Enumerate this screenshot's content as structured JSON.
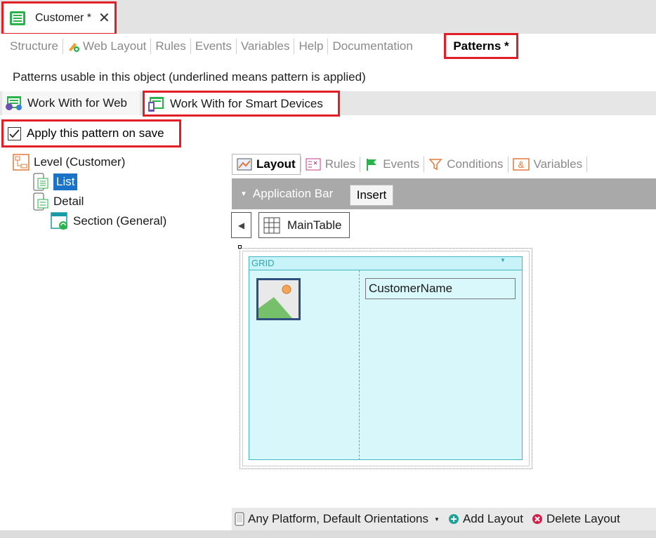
{
  "document_tab": {
    "label": "Customer *",
    "close_glyph": "✕",
    "icon": "transaction-icon"
  },
  "object_tabs": [
    {
      "label": "Structure"
    },
    {
      "label": "Web Layout",
      "icon": "web-layout-icon"
    },
    {
      "label": "Rules"
    },
    {
      "label": "Events"
    },
    {
      "label": "Variables"
    },
    {
      "label": "Help"
    },
    {
      "label": "Documentation"
    }
  ],
  "active_object_tab": "Patterns *",
  "description": "Patterns usable in this object (underlined means pattern is applied)",
  "pattern_tabs": {
    "web": "Work With for Web",
    "smart_devices": "Work With for Smart Devices"
  },
  "apply_checkbox": {
    "label": "Apply this pattern on save",
    "checked": true
  },
  "tree": {
    "level": "Level (Customer)",
    "list": "List",
    "detail": "Detail",
    "section": "Section (General)"
  },
  "layout_tabs": {
    "layout": "Layout",
    "rules": "Rules",
    "events": "Events",
    "conditions": "Conditions",
    "variables": "Variables"
  },
  "app_bar": {
    "label": "Application Bar",
    "insert": "Insert"
  },
  "maintable": "MainTable",
  "grid": {
    "title": "GRID",
    "field": "CustomerName"
  },
  "bottom_bar": {
    "platform": "Any Platform, Default Orientations",
    "add": "Add Layout",
    "delete": "Delete Layout"
  },
  "colors": {
    "highlight": "#e11f26",
    "selection": "#1a73c7",
    "grid": "#3fb8c4"
  }
}
